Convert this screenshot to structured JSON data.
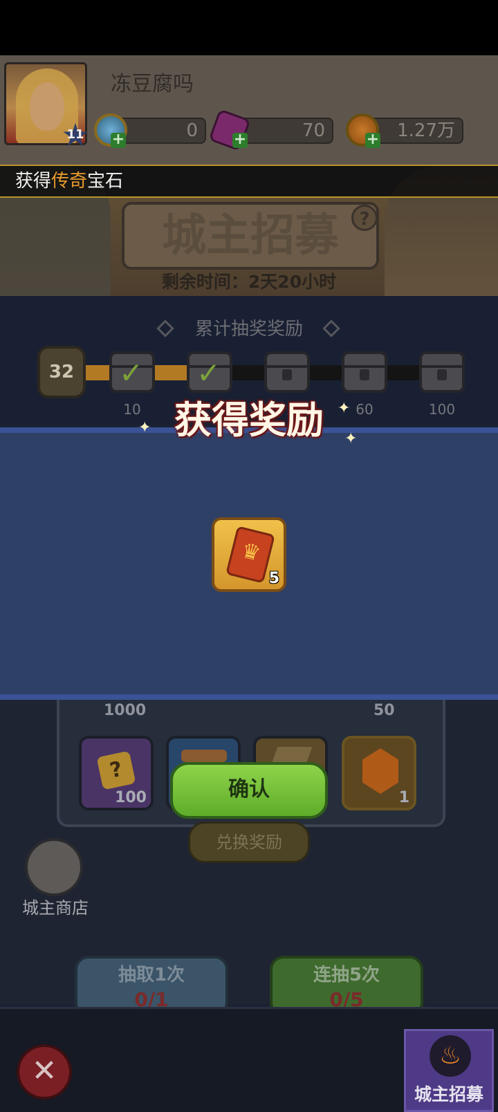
{
  "player": {
    "name": "冻豆腐吗",
    "level": "11"
  },
  "resources": [
    {
      "icon": "blue-gem-coin-icon",
      "value": "0"
    },
    {
      "icon": "purple-crystal-icon",
      "value": "70"
    },
    {
      "icon": "gold-coin-icon",
      "value": "1.27万"
    }
  ],
  "notice": {
    "prefix": "获得",
    "highlight": "传奇",
    "suffix": "宝石"
  },
  "banner": {
    "title": "城主招募",
    "help": "?",
    "remaining_time": "剩余时间：2天20小时"
  },
  "cumulative": {
    "title": "累计抽奖奖励",
    "count": "32",
    "progress_fraction": 0.35,
    "milestones": [
      {
        "label": "10",
        "claimed": true
      },
      {
        "label": "",
        "claimed": true
      },
      {
        "label": "",
        "claimed": false
      },
      {
        "label": "60",
        "claimed": false
      },
      {
        "label": "100",
        "claimed": false
      }
    ]
  },
  "reward_modal": {
    "title": "获得奖励",
    "item": {
      "icon": "recruit-ticket-icon",
      "quantity": "5"
    },
    "confirm_label": "确认"
  },
  "shop": {
    "top_quantities": [
      "1000",
      "50"
    ],
    "slots": [
      {
        "icon": "puzzle-piece-icon",
        "quantity": "100"
      },
      {
        "icon": "scroll-icon",
        "quantity": ""
      },
      {
        "icon": "book-icon",
        "quantity": ""
      },
      {
        "icon": "orange-gem-icon",
        "quantity": "1"
      }
    ],
    "exchange_label": "兑换奖励",
    "store_label": "城主商店"
  },
  "draw": {
    "single": {
      "label": "抽取1次",
      "count": "0/1"
    },
    "multi": {
      "label": "连抽5次",
      "count": "0/5"
    }
  },
  "bottom_tab": {
    "label": "城主招募"
  },
  "colors": {
    "accent_orange": "#e89a2c",
    "confirm_green": "#6cc235",
    "modal_blue": "#2f4067",
    "tab_purple": "#4e3a86"
  }
}
